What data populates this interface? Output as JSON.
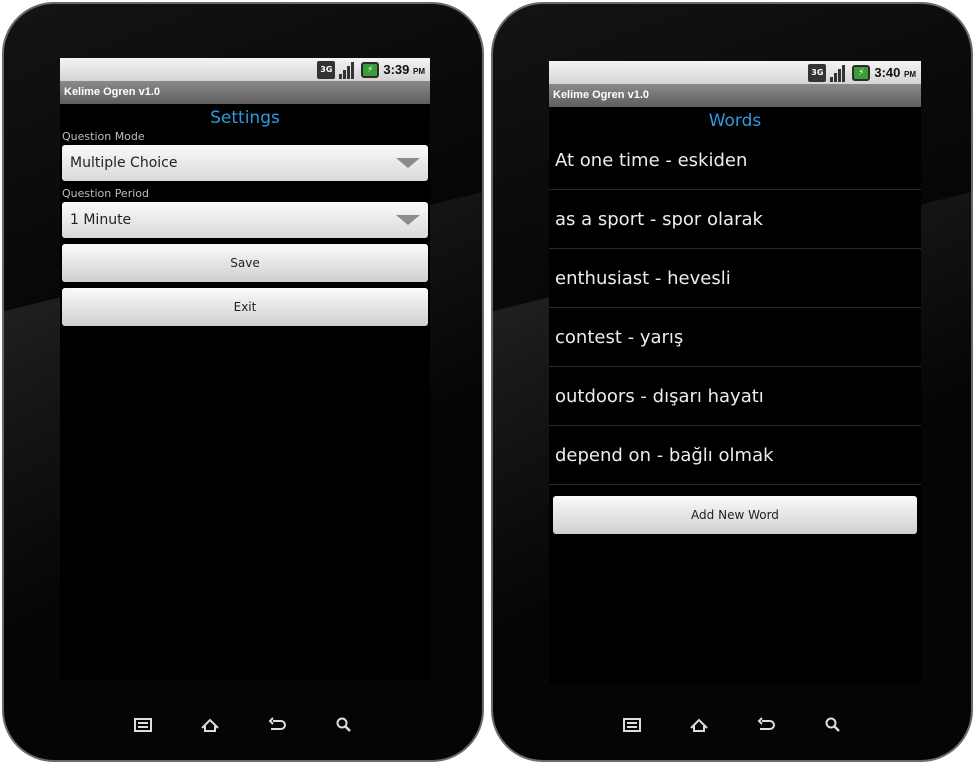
{
  "left": {
    "status": {
      "net": "3G",
      "battery": "⚡",
      "time": "3:39",
      "ampm": "PM"
    },
    "app_title": "Kelime Ogren v1.0",
    "heading": "Settings",
    "question_mode_label": "Question Mode",
    "question_mode_value": "Multiple Choice",
    "question_period_label": "Question Period",
    "question_period_value": "1 Minute",
    "save_label": "Save",
    "exit_label": "Exit"
  },
  "right": {
    "status": {
      "net": "3G",
      "battery": "⚡",
      "time": "3:40",
      "ampm": "PM"
    },
    "app_title": "Kelime Ogren v1.0",
    "heading": "Words",
    "words": [
      "At one time - eskiden",
      "as a sport - spor olarak",
      "enthusiast - hevesli",
      "contest - yarış",
      "outdoors - dışarı hayatı",
      "depend on - bağlı olmak"
    ],
    "add_label": "Add New Word"
  },
  "nav_icons": [
    "menu-icon",
    "home-icon",
    "back-icon",
    "search-icon"
  ],
  "colors": {
    "accent": "#2e9ae0",
    "battery": "#3a9d3a"
  }
}
